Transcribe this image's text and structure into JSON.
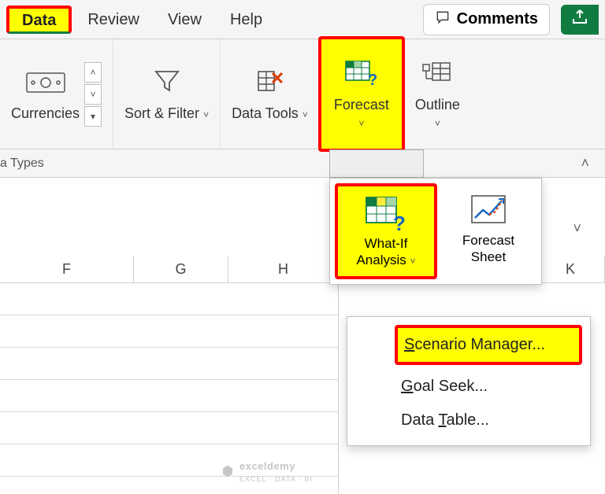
{
  "tabs": {
    "data": "Data",
    "review": "Review",
    "view": "View",
    "help": "Help"
  },
  "header": {
    "comments": "Comments"
  },
  "ribbon": {
    "currencies": "Currencies",
    "sort_filter": "Sort & Filter",
    "data_tools": "Data Tools",
    "forecast": "Forecast",
    "outline": "Outline"
  },
  "groups_strip": {
    "left_label": "a Types"
  },
  "columns": [
    "F",
    "G",
    "H",
    "K"
  ],
  "forecast_dropdown": {
    "what_if": "What-If Analysis",
    "forecast_sheet": "Forecast Sheet"
  },
  "whatif_menu": {
    "scenario": "Scenario Manager...",
    "scenario_ul": "S",
    "goal": "Goal Seek...",
    "goal_ul": "G",
    "table": "Data Table...",
    "table_ul": "T"
  },
  "watermark": {
    "brand": "exceldemy",
    "tag": "EXCEL · DATA · BI"
  }
}
